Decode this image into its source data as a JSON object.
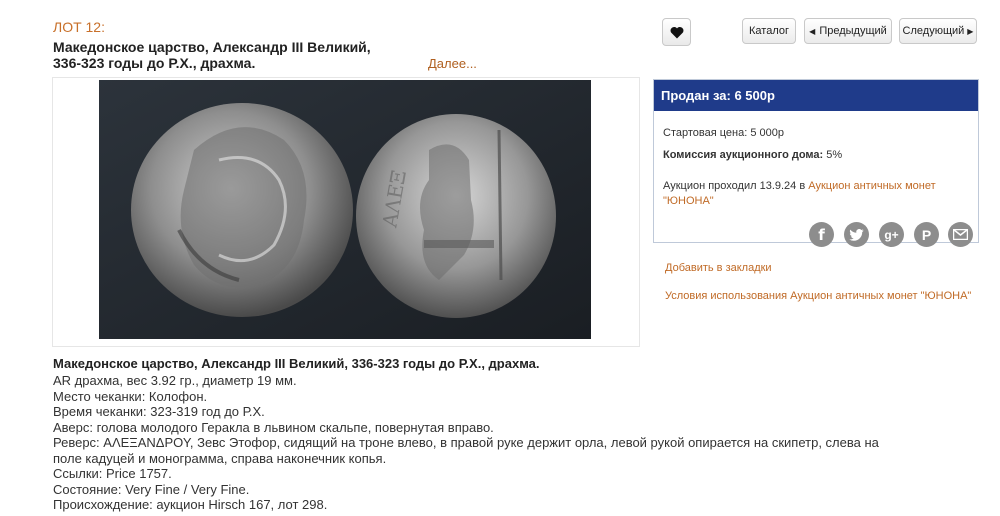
{
  "lot": {
    "number_label": "ЛОТ 12:",
    "title_line1": "Македонское царство, Александр III Великий,",
    "title_line2": "336-323 годы до Р.Х., драхма.",
    "more_link": "Далее..."
  },
  "toolbar": {
    "favorite_icon": "heart-icon",
    "catalog_label": "Каталог",
    "prev_label": "Предыдущий",
    "next_label": "Следующий"
  },
  "sale": {
    "sold_for": "Продан за: 6 500р",
    "start_price": "Стартовая цена: 5 000р",
    "commission_label": "Комиссия аукционного дома:",
    "commission_value": "5%",
    "auction_text": "Аукцион проходил 13.9.24 в",
    "auction_link_line1": "Аукцион античных монет",
    "auction_link_line2": "\"ЮНОНА\""
  },
  "share": {
    "icons": [
      "facebook-icon",
      "twitter-icon",
      "google-plus-icon",
      "pinterest-icon",
      "email-icon"
    ],
    "facebook": "f",
    "google": "g+",
    "pinterest": "P"
  },
  "links": {
    "bookmark": "Добавить в закладки",
    "terms": "Условия использования Аукцион античных монет \"ЮНОНА\""
  },
  "description": {
    "title": "Македонское царство, Александр III Великий, 336-323 годы до Р.Х., драхма.",
    "line1": "AR драхма, вес 3.92 гр., диаметр 19 мм.",
    "line2": "Место чеканки: Колофон.",
    "line3": "Время чеканки: 323-319 год до Р.Х.",
    "line4": "Аверс: голова молодого Геракла в львином скальпе, повернутая вправо.",
    "line5": "Реверс: ΑΛΕΞΑΝΔΡΟΥ, Зевс Этофор, сидящий на троне влево, в правой руке держит орла, левой рукой опирается на скипетр, слева на",
    "line6": "поле кадуцей и монограмма, справа наконечник копья.",
    "line7": "Ссылки: Price 1757.",
    "line8": "Состояние: Very Fine / Very Fine.",
    "line9": "Происхождение: аукцион Hirsch 167, лот 298."
  },
  "colors": {
    "accent": "#c8702a",
    "header_blue": "#1f3b8a",
    "share_gray": "#8d8d8d"
  }
}
